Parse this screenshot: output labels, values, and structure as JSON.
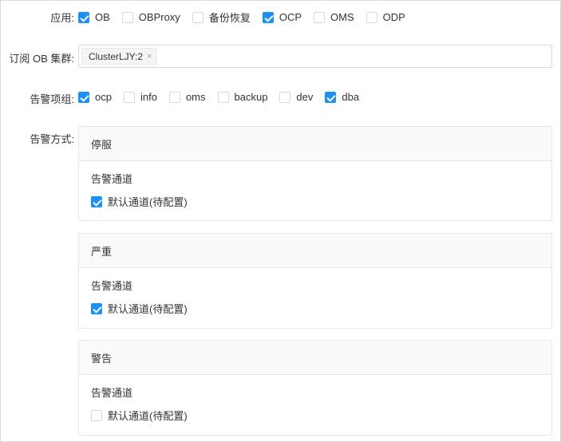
{
  "app_row": {
    "label": "应用:",
    "options": [
      {
        "label": "OB",
        "checked": true
      },
      {
        "label": "OBProxy",
        "checked": false
      },
      {
        "label": "备份恢复",
        "checked": false
      },
      {
        "label": "OCP",
        "checked": true
      },
      {
        "label": "OMS",
        "checked": false
      },
      {
        "label": "ODP",
        "checked": false
      }
    ]
  },
  "cluster_row": {
    "label": "订阅 OB 集群:",
    "tags": [
      {
        "label": "ClusterLJY:2",
        "close": "×"
      }
    ]
  },
  "group_row": {
    "label": "告警项组:",
    "options": [
      {
        "label": "ocp",
        "checked": true
      },
      {
        "label": "info",
        "checked": false
      },
      {
        "label": "oms",
        "checked": false
      },
      {
        "label": "backup",
        "checked": false
      },
      {
        "label": "dev",
        "checked": false
      },
      {
        "label": "dba",
        "checked": true
      }
    ]
  },
  "method_row": {
    "label": "告警方式:",
    "cards": [
      {
        "title": "停服",
        "channel_label": "告警通道",
        "option_label": "默认通道(待配置)",
        "checked": true
      },
      {
        "title": "严重",
        "channel_label": "告警通道",
        "option_label": "默认通道(待配置)",
        "checked": true
      },
      {
        "title": "警告",
        "channel_label": "告警通道",
        "option_label": "默认通道(待配置)",
        "checked": false
      }
    ]
  },
  "colors": {
    "primary": "#1890ff",
    "border": "#d9d9d9",
    "card_header_bg": "#fafafa",
    "text": "#333333"
  }
}
